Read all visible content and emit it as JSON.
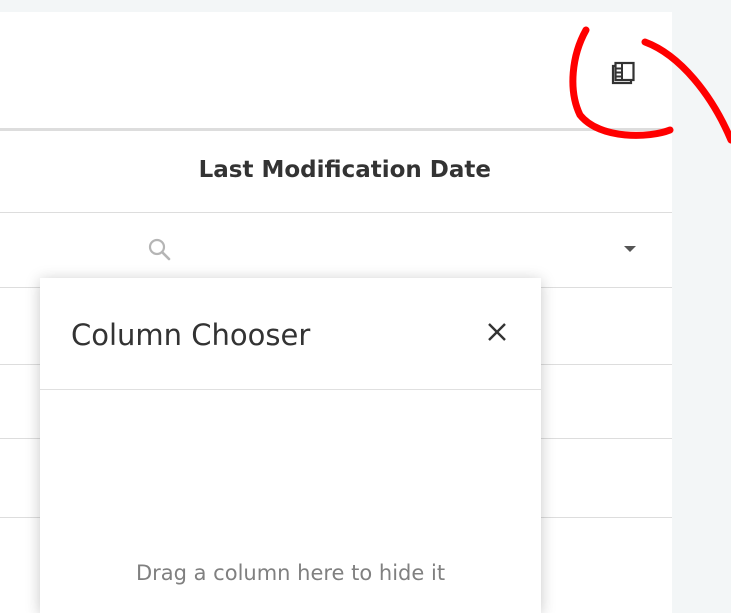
{
  "grid": {
    "column_header": "Last Modification Date"
  },
  "column_chooser": {
    "title": "Column Chooser",
    "empty_hint": "Drag a column here to hide it"
  },
  "icons": {
    "toolbar_button": "column-chooser-icon",
    "filter_search": "search-icon",
    "filter_dropdown": "caret-down-icon",
    "close": "close-icon"
  },
  "colors": {
    "annotation": "#ff0000",
    "header_text": "#333333",
    "hint_text": "#808080",
    "background_strip": "#f3f6f7",
    "border": "#dddddd"
  }
}
